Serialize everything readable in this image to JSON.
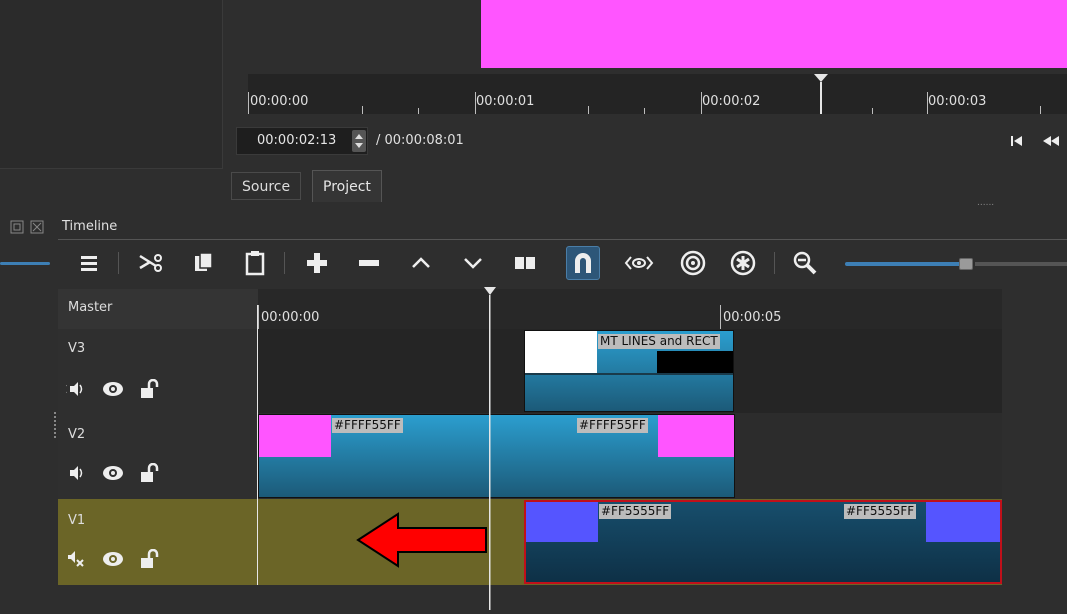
{
  "preview": {
    "ruler_labels": [
      "00:00:00",
      "00:00:01",
      "00:00:02",
      "00:00:03"
    ],
    "current_time": "00:00:02:13",
    "duration": "/ 00:00:08:01",
    "tabs": [
      "Source",
      "Project"
    ],
    "dots": "......",
    "frame_color": "#ff55ff"
  },
  "timeline": {
    "title": "Timeline",
    "ruler_labels": [
      "00:00:00",
      "00:00:05"
    ],
    "master_label": "Master",
    "tracks": [
      {
        "name": "V3",
        "clips": [
          {
            "label": "MT LINES and RECT"
          }
        ]
      },
      {
        "name": "V2",
        "clips": [
          {
            "label_start": "#FFFF55FF",
            "label_end": "#FFFF55FF"
          }
        ]
      },
      {
        "name": "V1",
        "clips": [
          {
            "label_start": "#FF5555FF",
            "label_end": "#FF5555FF"
          }
        ]
      }
    ]
  },
  "colors": {
    "accent": "#3d7fb5",
    "v1_bg": "#6b6527",
    "magenta": "#ff55ff",
    "blue_thumb": "#5555ff",
    "arrow": "#ff0000"
  },
  "icons": {
    "toolbar": [
      "menu-icon",
      "scissors-icon",
      "copy-icon",
      "paste-icon",
      "add-icon",
      "remove-icon",
      "lift-icon",
      "overwrite-icon",
      "split-icon",
      "snap-icon",
      "scrub-icon",
      "ripple-icon",
      "ripple-all-icon",
      "zoom-out-icon",
      "zoom-slider"
    ],
    "track_controls": [
      "volume-icon",
      "eye-icon",
      "lock-icon"
    ]
  }
}
